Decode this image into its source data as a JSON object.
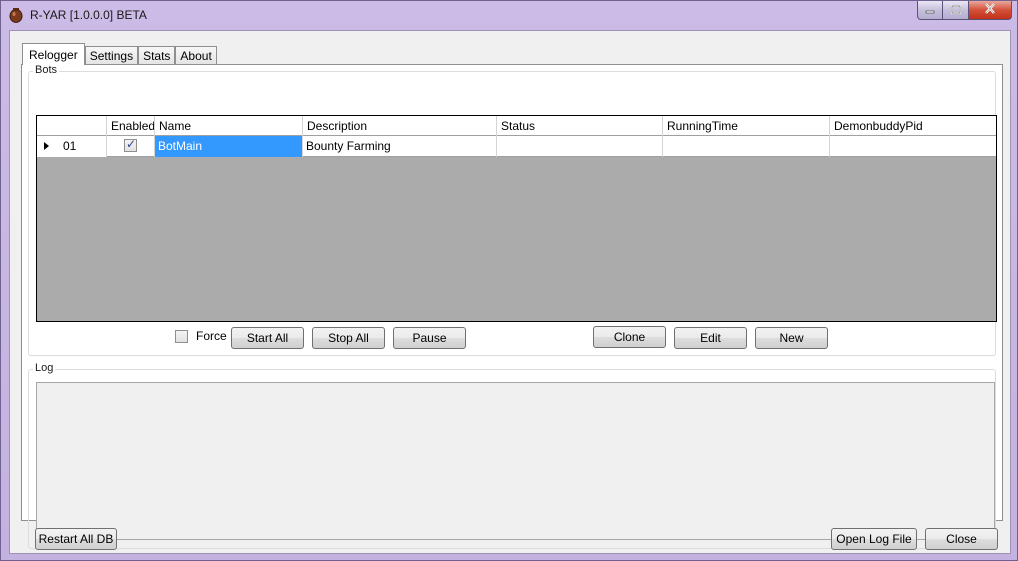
{
  "window": {
    "title": "R-YAR [1.0.0.0] BETA",
    "controls": {
      "minimize": "minimize",
      "maximize": "maximize",
      "close": "close"
    }
  },
  "tabs": [
    {
      "label": "Relogger",
      "active": true
    },
    {
      "label": "Settings",
      "active": false
    },
    {
      "label": "Stats",
      "active": false
    },
    {
      "label": "About",
      "active": false
    }
  ],
  "bots_group": {
    "label": "Bots",
    "columns": [
      "Enabled",
      "Name",
      "Description",
      "Status",
      "RunningTime",
      "DemonbuddyPid"
    ],
    "rows": [
      {
        "index": "01",
        "enabled": true,
        "name": "BotMain",
        "description": "Bounty Farming",
        "status": "",
        "running_time": "",
        "pid": ""
      }
    ],
    "force_label": "Force",
    "buttons": {
      "start_all": "Start All",
      "stop_all": "Stop All",
      "pause": "Pause",
      "clone": "Clone",
      "edit": "Edit",
      "new": "New"
    }
  },
  "log_group": {
    "label": "Log"
  },
  "footer": {
    "restart_all": "Restart All DB",
    "open_log": "Open Log File",
    "close": "Close"
  },
  "colors": {
    "selection": "#3399ff",
    "grid_background": "#ababab",
    "frame": "#c7b6e2"
  }
}
